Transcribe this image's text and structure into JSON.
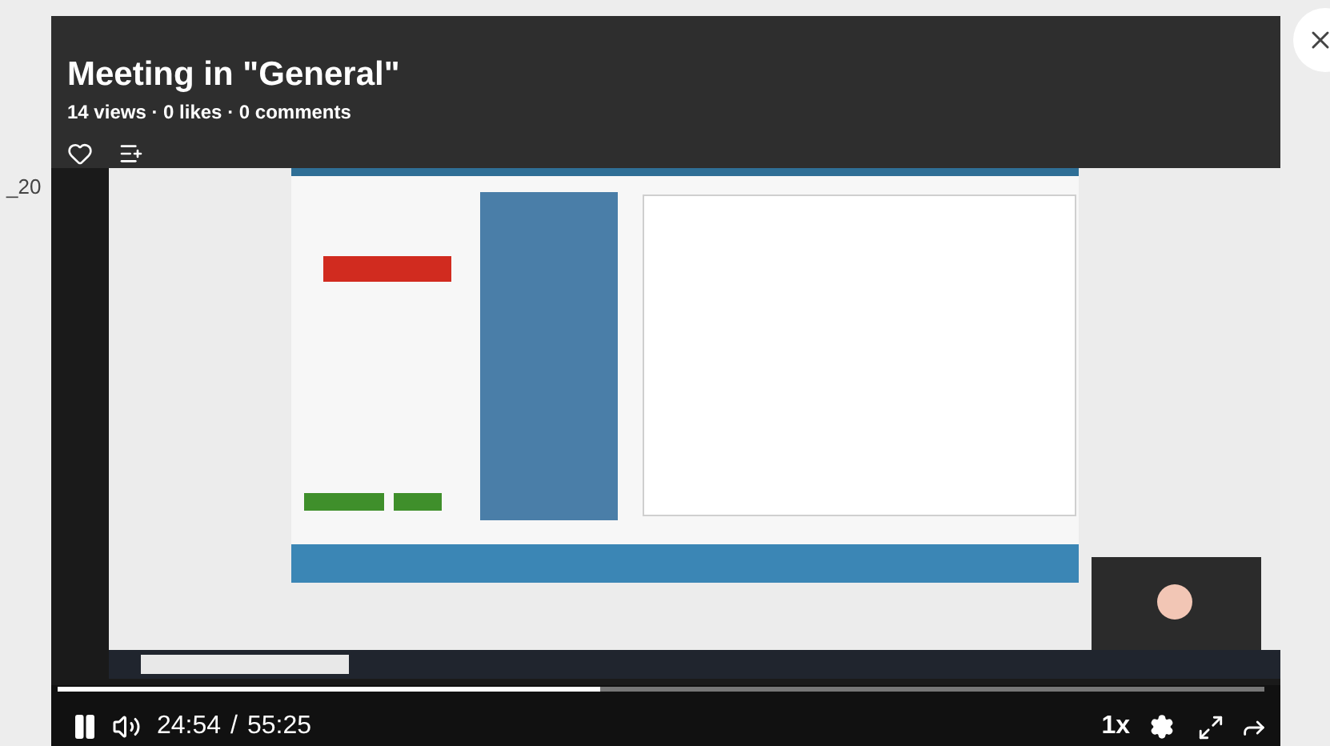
{
  "page_text": "_20",
  "video": {
    "kind": "picture",
    "title": "Meeting in \"General\"",
    "stats": "14 views · 0 likes · 0 comments",
    "liked": false
  },
  "player": {
    "playing": true,
    "level": 0.45,
    "current_time": "24:54",
    "separator": "/",
    "duration": "55:25",
    "speed": "1x"
  }
}
